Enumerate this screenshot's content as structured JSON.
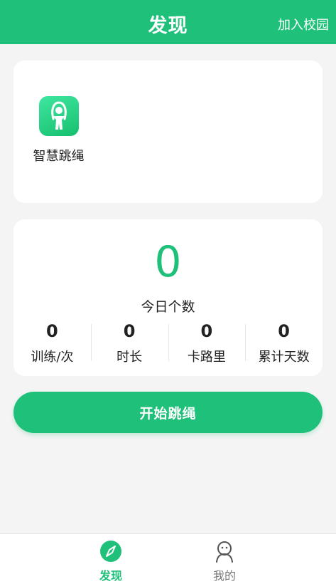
{
  "header": {
    "title": "发现",
    "action_label": "加入校园"
  },
  "features": [
    {
      "label": "智慧跳绳",
      "icon": "jump-rope-person-icon"
    }
  ],
  "today": {
    "count": "0",
    "label": "今日个数"
  },
  "stats": [
    {
      "value": "0",
      "label": "训练/次"
    },
    {
      "value": "0",
      "label": "时长"
    },
    {
      "value": "0",
      "label": "卡路里"
    },
    {
      "value": "0",
      "label": "累计天数"
    }
  ],
  "start_button": {
    "label": "开始跳绳"
  },
  "nav": {
    "items": [
      {
        "label": "发现",
        "icon": "compass-icon",
        "active": true
      },
      {
        "label": "我的",
        "icon": "profile-icon",
        "active": false
      }
    ]
  },
  "colors": {
    "accent": "#1ec07a",
    "background": "#f4f4f4",
    "card": "#ffffff"
  }
}
